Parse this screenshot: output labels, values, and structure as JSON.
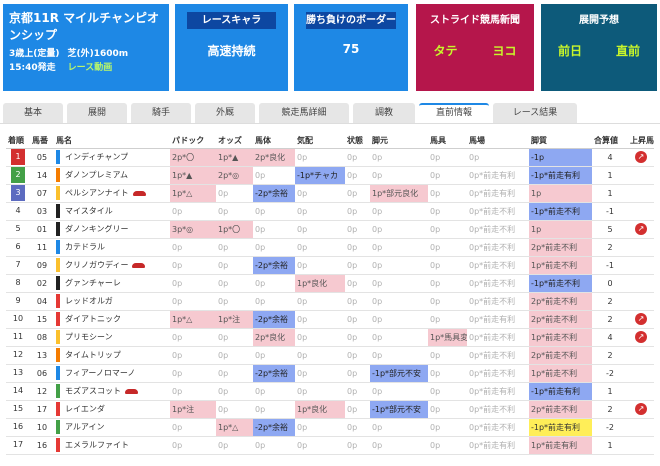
{
  "race": {
    "title": "京都11R マイルチャンピオンシップ",
    "cond": "3歳上(定量)",
    "course": "芝(外)1600m",
    "time": "15:40発走",
    "video": "レース動画"
  },
  "cards": [
    {
      "head": "レースキャラ",
      "value": "高速持続"
    },
    {
      "head": "勝ち負けのボーダー",
      "value": "75"
    },
    {
      "head": "ストライド競馬新聞",
      "left": "タテ",
      "right": "ヨコ"
    },
    {
      "head": "展開予想",
      "left": "前日",
      "right": "直前"
    }
  ],
  "tabs": [
    "基本",
    "展開",
    "騎手",
    "外厩",
    "競走馬詳細",
    "調教",
    "直前情報",
    "レース結果"
  ],
  "active_tab": 6,
  "columns": [
    "着順",
    "馬番",
    "馬名",
    "パドック",
    "オッズ",
    "馬体",
    "気配",
    "状態",
    "脚元",
    "馬具",
    "馬場",
    "脚質",
    "合算値",
    "上昇馬"
  ],
  "colors": {
    "gate1": "#d32f2f",
    "gate2": "#43a047",
    "gate3": "#5c6bc0"
  },
  "rows": [
    {
      "rank": "1",
      "num": "05",
      "name": "インディチャンプ",
      "bar": "#1e88e5",
      "hat": false,
      "pad": "2p*〇",
      "padc": "pk",
      "odds": "1p*▲",
      "oddsc": "pk",
      "body": "2p*良化",
      "bodyc": "pk",
      "kehai": "0p",
      "kehaic": "g",
      "state": "0p",
      "ashi": "0p",
      "ashic": "g",
      "bagu": "0p",
      "baguc": "g",
      "baba": "0p",
      "babac": "g",
      "kyaku": "-1p",
      "kyakuc": "bl",
      "sum": "4",
      "up": true
    },
    {
      "rank": "2",
      "num": "14",
      "name": "ダノンプレミアム",
      "bar": "#f57c00",
      "hat": false,
      "pad": "1p*▲",
      "padc": "pk",
      "odds": "2p*◎",
      "oddsc": "pk",
      "body": "0p",
      "bodyc": "g",
      "kehai": "-1p*チャカ",
      "kehaic": "bl",
      "state": "0p",
      "ashi": "0p",
      "ashic": "g",
      "bagu": "0p",
      "baguc": "g",
      "baba": "0p*前走有利",
      "babac": "g",
      "kyaku": "-1p*前走有利",
      "kyakuc": "bl",
      "sum": "1",
      "up": false
    },
    {
      "rank": "3",
      "num": "07",
      "name": "ペルシアンナイト",
      "bar": "#fbc02d",
      "hat": true,
      "pad": "1p*△",
      "padc": "pk",
      "odds": "0p",
      "oddsc": "g",
      "body": "-2p*余裕",
      "bodyc": "bl",
      "kehai": "0p",
      "kehaic": "g",
      "state": "0p",
      "ashi": "1p*部元良化",
      "ashic": "pk",
      "bagu": "0p",
      "baguc": "g",
      "baba": "0p*前走有利",
      "babac": "g",
      "kyaku": "1p",
      "kyakuc": "pk",
      "sum": "1",
      "up": false
    },
    {
      "rank": "4",
      "num": "03",
      "name": "マイスタイル",
      "bar": "#212121",
      "hat": false,
      "pad": "0p",
      "padc": "g",
      "odds": "0p",
      "oddsc": "g",
      "body": "0p",
      "bodyc": "g",
      "kehai": "0p",
      "kehaic": "g",
      "state": "0p",
      "ashi": "0p",
      "ashic": "g",
      "bagu": "0p",
      "baguc": "g",
      "baba": "0p*前走不利",
      "babac": "g",
      "kyaku": "-1p*前走不利",
      "kyakuc": "bl",
      "sum": "-1",
      "up": false
    },
    {
      "rank": "5",
      "num": "01",
      "name": "ダノンキングリー",
      "bar": "#212121",
      "hat": false,
      "pad": "3p*◎",
      "padc": "pk",
      "odds": "1p*〇",
      "oddsc": "pk",
      "body": "0p",
      "bodyc": "g",
      "kehai": "0p",
      "kehaic": "g",
      "state": "0p",
      "ashi": "0p",
      "ashic": "g",
      "bagu": "0p",
      "baguc": "g",
      "baba": "0p*前走不利",
      "babac": "g",
      "kyaku": "1p",
      "kyakuc": "pk",
      "sum": "5",
      "up": true
    },
    {
      "rank": "6",
      "num": "11",
      "name": "カテドラル",
      "bar": "#1e88e5",
      "hat": false,
      "pad": "0p",
      "padc": "g",
      "odds": "0p",
      "oddsc": "g",
      "body": "0p",
      "bodyc": "g",
      "kehai": "0p",
      "kehaic": "g",
      "state": "0p",
      "ashi": "0p",
      "ashic": "g",
      "bagu": "0p",
      "baguc": "g",
      "baba": "0p*前走不利",
      "babac": "g",
      "kyaku": "2p*前走不利",
      "kyakuc": "pk",
      "sum": "2",
      "up": false
    },
    {
      "rank": "7",
      "num": "09",
      "name": "クリノガウディー",
      "bar": "#fbc02d",
      "hat": true,
      "pad": "0p",
      "padc": "g",
      "odds": "0p",
      "oddsc": "g",
      "body": "-2p*余裕",
      "bodyc": "bl",
      "kehai": "0p",
      "kehaic": "g",
      "state": "0p",
      "ashi": "0p",
      "ashic": "g",
      "bagu": "0p",
      "baguc": "g",
      "baba": "0p*前走不利",
      "babac": "g",
      "kyaku": "1p*前走不利",
      "kyakuc": "pk",
      "sum": "-1",
      "up": false
    },
    {
      "rank": "8",
      "num": "02",
      "name": "グァンチャーレ",
      "bar": "#212121",
      "hat": false,
      "pad": "0p",
      "padc": "g",
      "odds": "0p",
      "oddsc": "g",
      "body": "0p",
      "bodyc": "g",
      "kehai": "1p*良化",
      "kehaic": "pk",
      "state": "0p",
      "ashi": "0p",
      "ashic": "g",
      "bagu": "0p",
      "baguc": "g",
      "baba": "0p*前走不利",
      "babac": "g",
      "kyaku": "-1p*前走不利",
      "kyakuc": "bl",
      "sum": "0",
      "up": false
    },
    {
      "rank": "9",
      "num": "04",
      "name": "レッドオルガ",
      "bar": "#e53935",
      "hat": false,
      "pad": "0p",
      "padc": "g",
      "odds": "0p",
      "oddsc": "g",
      "body": "0p",
      "bodyc": "g",
      "kehai": "0p",
      "kehaic": "g",
      "state": "0p",
      "ashi": "0p",
      "ashic": "g",
      "bagu": "0p",
      "baguc": "g",
      "baba": "0p*前走不利",
      "babac": "g",
      "kyaku": "2p*前走不利",
      "kyakuc": "pk",
      "sum": "2",
      "up": false
    },
    {
      "rank": "10",
      "num": "15",
      "name": "ダイアトニック",
      "bar": "#e53935",
      "hat": false,
      "pad": "1p*△",
      "padc": "pk",
      "odds": "1p*注",
      "oddsc": "pk",
      "body": "-2p*余裕",
      "bodyc": "bl",
      "kehai": "0p",
      "kehaic": "g",
      "state": "0p",
      "ashi": "0p",
      "ashic": "g",
      "bagu": "0p",
      "baguc": "g",
      "baba": "0p*前走有利",
      "babac": "g",
      "kyaku": "2p*前走不利",
      "kyakuc": "pk",
      "sum": "2",
      "up": true
    },
    {
      "rank": "11",
      "num": "08",
      "name": "プリモシーン",
      "bar": "#fbc02d",
      "hat": false,
      "pad": "0p",
      "padc": "g",
      "odds": "0p",
      "oddsc": "g",
      "body": "2p*良化",
      "bodyc": "pk",
      "kehai": "0p",
      "kehaic": "g",
      "state": "0p",
      "ashi": "0p",
      "ashic": "g",
      "bagu": "1p*馬具変",
      "baguc": "pk",
      "baba": "0p*前走不利",
      "babac": "g",
      "kyaku": "1p*前走不利",
      "kyakuc": "pk",
      "sum": "4",
      "up": true
    },
    {
      "rank": "12",
      "num": "13",
      "name": "タイムトリップ",
      "bar": "#f57c00",
      "hat": false,
      "pad": "0p",
      "padc": "g",
      "odds": "0p",
      "oddsc": "g",
      "body": "0p",
      "bodyc": "g",
      "kehai": "0p",
      "kehaic": "g",
      "state": "0p",
      "ashi": "0p",
      "ashic": "g",
      "bagu": "0p",
      "baguc": "g",
      "baba": "0p*前走不利",
      "babac": "g",
      "kyaku": "2p*前走不利",
      "kyakuc": "pk",
      "sum": "2",
      "up": false
    },
    {
      "rank": "13",
      "num": "06",
      "name": "フィアーノロマーノ",
      "bar": "#1e88e5",
      "hat": false,
      "pad": "0p",
      "padc": "g",
      "odds": "0p",
      "oddsc": "g",
      "body": "-2p*余裕",
      "bodyc": "bl",
      "kehai": "0p",
      "kehaic": "g",
      "state": "0p",
      "ashi": "-1p*部元不安",
      "ashic": "bl",
      "bagu": "0p",
      "baguc": "g",
      "baba": "0p*前走不利",
      "babac": "g",
      "kyaku": "1p*前走不利",
      "kyakuc": "pk",
      "sum": "-2",
      "up": false
    },
    {
      "rank": "14",
      "num": "12",
      "name": "モズアスコット",
      "bar": "#43a047",
      "hat": true,
      "pad": "0p",
      "padc": "g",
      "odds": "0p",
      "oddsc": "g",
      "body": "0p",
      "bodyc": "g",
      "kehai": "0p",
      "kehaic": "g",
      "state": "0p",
      "ashi": "0p",
      "ashic": "g",
      "bagu": "0p",
      "baguc": "g",
      "baba": "0p*前走有利",
      "babac": "g",
      "kyaku": "-1p*前走有利",
      "kyakuc": "bl",
      "sum": "1",
      "up": false
    },
    {
      "rank": "15",
      "num": "17",
      "name": "レイエンダ",
      "bar": "#e53935",
      "hat": false,
      "pad": "1p*注",
      "padc": "pk",
      "odds": "0p",
      "oddsc": "g",
      "body": "0p",
      "bodyc": "g",
      "kehai": "1p*良化",
      "kehaic": "pk",
      "state": "0p",
      "ashi": "-1p*部元不安",
      "ashic": "bl",
      "bagu": "0p",
      "baguc": "g",
      "baba": "0p*前走不利",
      "babac": "g",
      "kyaku": "2p*前走不利",
      "kyakuc": "pk",
      "sum": "2",
      "up": true
    },
    {
      "rank": "16",
      "num": "10",
      "name": "アルアイン",
      "bar": "#43a047",
      "hat": false,
      "pad": "0p",
      "padc": "g",
      "odds": "1p*△",
      "oddsc": "pk",
      "body": "-2p*余裕",
      "bodyc": "bl",
      "kehai": "0p",
      "kehaic": "g",
      "state": "0p",
      "ashi": "0p",
      "ashic": "g",
      "bagu": "0p",
      "baguc": "g",
      "baba": "0p*前走不利",
      "babac": "g",
      "kyaku": "-1p*前走有利",
      "kyakuc": "yl",
      "sum": "-2",
      "up": false
    },
    {
      "rank": "17",
      "num": "16",
      "name": "エメラルファイト",
      "bar": "#e53935",
      "hat": false,
      "pad": "0p",
      "padc": "g",
      "odds": "0p",
      "oddsc": "g",
      "body": "0p",
      "bodyc": "g",
      "kehai": "0p",
      "kehaic": "g",
      "state": "0p",
      "ashi": "0p",
      "ashic": "g",
      "bagu": "0p",
      "baguc": "g",
      "baba": "0p*前走有利",
      "babac": "g",
      "kyaku": "1p*前走有利",
      "kyakuc": "pk",
      "sum": "1",
      "up": false
    }
  ]
}
